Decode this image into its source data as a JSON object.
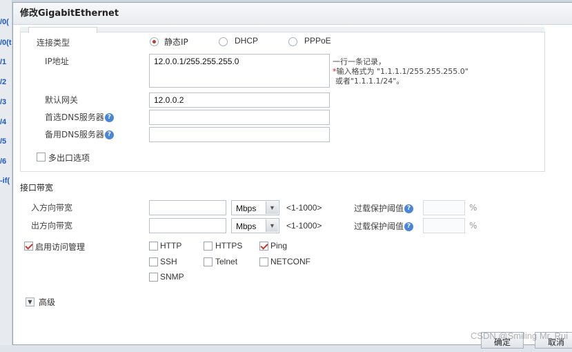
{
  "background": {
    "row_labels": [
      "/0(",
      "/0(t",
      "/1",
      "/2",
      "/3",
      "/4",
      "/5",
      "/6",
      "-if("
    ]
  },
  "dialog": {
    "title": "修改GigabitEthernet"
  },
  "connection": {
    "label": "连接类型",
    "options": [
      "静态IP",
      "DHCP",
      "PPPoE"
    ],
    "selected": "静态IP",
    "ip_label": "IP地址",
    "ip_value": "12.0.0.1/255.255.255.0",
    "ip_hint_line1": "一行一条记录，",
    "ip_hint_star": "*",
    "ip_hint_line2": "输入格式为 \"1.1.1.1/255.255.255.0\"",
    "ip_hint_line3": "或者\"1.1.1.1/24\"。",
    "gateway_label": "默认网关",
    "gateway_value": "12.0.0.2",
    "dns1_label": "首选DNS服务器",
    "dns1_value": "",
    "dns2_label": "备用DNS服务器",
    "dns2_value": "",
    "help_glyph": "?",
    "multi_exit_label": "多出口选项",
    "multi_exit_checked": false
  },
  "bandwidth": {
    "heading": "接口带宽",
    "in_label": "入方向带宽",
    "in_value": "",
    "out_label": "出方向带宽",
    "out_value": "",
    "unit": "Mbps",
    "range": "<1-1000>",
    "threshold_label": "过载保护阈值",
    "percent": "%"
  },
  "access": {
    "label": "启用访问管理",
    "enabled": true,
    "protocols": [
      {
        "name": "HTTP",
        "checked": false
      },
      {
        "name": "HTTPS",
        "checked": false
      },
      {
        "name": "Ping",
        "checked": true
      },
      {
        "name": "SSH",
        "checked": false
      },
      {
        "name": "Telnet",
        "checked": false
      },
      {
        "name": "NETCONF",
        "checked": false
      },
      {
        "name": "SNMP",
        "checked": false
      }
    ]
  },
  "advanced": {
    "label": "高级",
    "toggle_glyph": "▼"
  },
  "footer": {
    "ok_label": "确定",
    "cancel_label": "取消"
  },
  "watermark": "CSDN @Smiling Mr. Rui",
  "colors": {
    "accent": "#c0392b",
    "help": "#4a86d8",
    "link_blue": "#1a56c4"
  }
}
